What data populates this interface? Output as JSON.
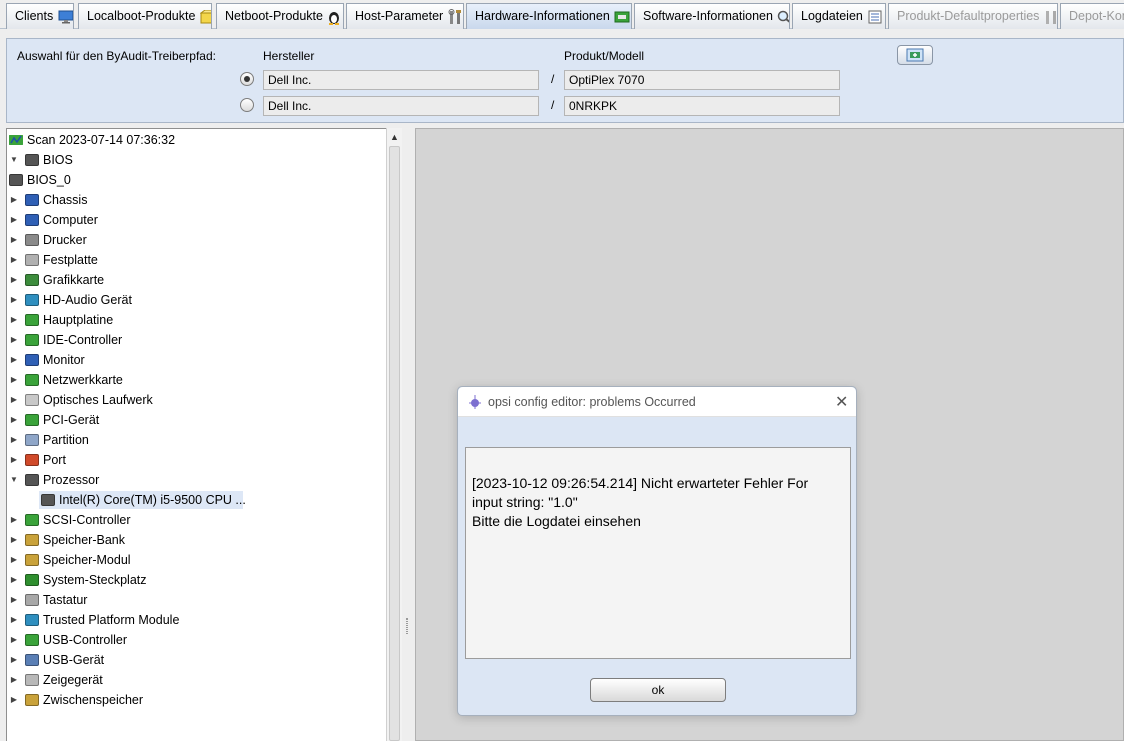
{
  "tabs": [
    {
      "label": "Clients",
      "icon": "monitor-icon"
    },
    {
      "label": "Localboot-Produkte",
      "icon": "package-icon"
    },
    {
      "label": "Netboot-Produkte",
      "icon": "linux-icon"
    },
    {
      "label": "Host-Parameter",
      "icon": "tools-icon"
    },
    {
      "label": "Hardware-Informationen",
      "icon": "hardware-icon",
      "active": true
    },
    {
      "label": "Software-Informationen",
      "icon": "search-icon"
    },
    {
      "label": "Logdateien",
      "icon": "logfile-icon"
    },
    {
      "label": "Produkt-Defaultproperties",
      "icon": "tools-icon",
      "disabled": true
    },
    {
      "label": "Depot-Konfiguration",
      "icon": "config-icon",
      "disabled": true
    }
  ],
  "driver_path": {
    "label": "Auswahl für den ByAudit-Treiberpfad:",
    "col_vendor": "Hersteller",
    "col_model": "Produkt/Modell",
    "separator": "/",
    "rows": [
      {
        "vendor": "Dell Inc.",
        "model": "OptiPlex 7070",
        "selected": true
      },
      {
        "vendor": "Dell Inc.",
        "model": "0NRKPK",
        "selected": false
      }
    ]
  },
  "tree": {
    "root": "Scan 2023-07-14 07:36:32",
    "items": [
      {
        "label": "BIOS",
        "expanded": true,
        "icon": "chip-icon",
        "color": "#555555"
      },
      {
        "label": "BIOS_0",
        "child": true,
        "icon": "chip-icon",
        "color": "#555555"
      },
      {
        "label": "Chassis",
        "icon": "chassis-icon",
        "color": "#2f5fb5"
      },
      {
        "label": "Computer",
        "icon": "computer-icon",
        "color": "#2f5fb5"
      },
      {
        "label": "Drucker",
        "icon": "printer-icon",
        "color": "#8a8a8a"
      },
      {
        "label": "Festplatte",
        "icon": "harddisk-icon",
        "color": "#b0b0b0"
      },
      {
        "label": "Grafikkarte",
        "icon": "graphics-card-icon",
        "color": "#3c8c3c"
      },
      {
        "label": "HD-Audio Gerät",
        "icon": "audio-icon",
        "color": "#2f8fbf"
      },
      {
        "label": "Hauptplatine",
        "icon": "mainboard-icon",
        "color": "#3aa33a"
      },
      {
        "label": "IDE-Controller",
        "icon": "card-icon",
        "color": "#3aa33a"
      },
      {
        "label": "Monitor",
        "icon": "monitor-icon",
        "color": "#2f5fb5"
      },
      {
        "label": "Netzwerkkarte",
        "icon": "network-card-icon",
        "color": "#3aa33a"
      },
      {
        "label": "Optisches Laufwerk",
        "icon": "cd-icon",
        "color": "#c8c8c8"
      },
      {
        "label": "PCI-Gerät",
        "icon": "card-icon",
        "color": "#3aa33a"
      },
      {
        "label": "Partition",
        "icon": "partition-icon",
        "color": "#8fa6c8"
      },
      {
        "label": "Port",
        "icon": "port-icon",
        "color": "#d04a2a"
      },
      {
        "label": "Prozessor",
        "expanded": true,
        "icon": "chip-icon",
        "color": "#555555"
      },
      {
        "label": "Intel(R) Core(TM) i5-9500 CPU ...",
        "child": true,
        "selected": true,
        "icon": "chip-icon",
        "color": "#555555"
      },
      {
        "label": "SCSI-Controller",
        "icon": "card-icon",
        "color": "#3aa33a"
      },
      {
        "label": "Speicher-Bank",
        "icon": "memory-icon",
        "color": "#c9a23a"
      },
      {
        "label": "Speicher-Modul",
        "icon": "memory-icon",
        "color": "#c9a23a"
      },
      {
        "label": "System-Steckplatz",
        "icon": "slot-icon",
        "color": "#2f8f2f"
      },
      {
        "label": "Tastatur",
        "icon": "keyboard-icon",
        "color": "#a8a8a8"
      },
      {
        "label": "Trusted Platform Module",
        "icon": "tpm-icon",
        "color": "#2f8fbf"
      },
      {
        "label": "USB-Controller",
        "icon": "card-icon",
        "color": "#3aa33a"
      },
      {
        "label": "USB-Gerät",
        "icon": "usb-icon",
        "color": "#5a7fb5"
      },
      {
        "label": "Zeigegerät",
        "icon": "mouse-icon",
        "color": "#b8b8b8"
      },
      {
        "label": "Zwischenspeicher",
        "icon": "memory-icon",
        "color": "#c9a23a"
      }
    ]
  },
  "dialog": {
    "title": "opsi config editor: problems Occurred",
    "message_line1": "[2023-10-12 09:26:54.214] Nicht erwarteter Fehler For",
    "message_line2": "input string: \"1.0\"",
    "message_line3": "Bitte die Logdatei einsehen",
    "ok_label": "ok",
    "close_symbol": "✕"
  }
}
